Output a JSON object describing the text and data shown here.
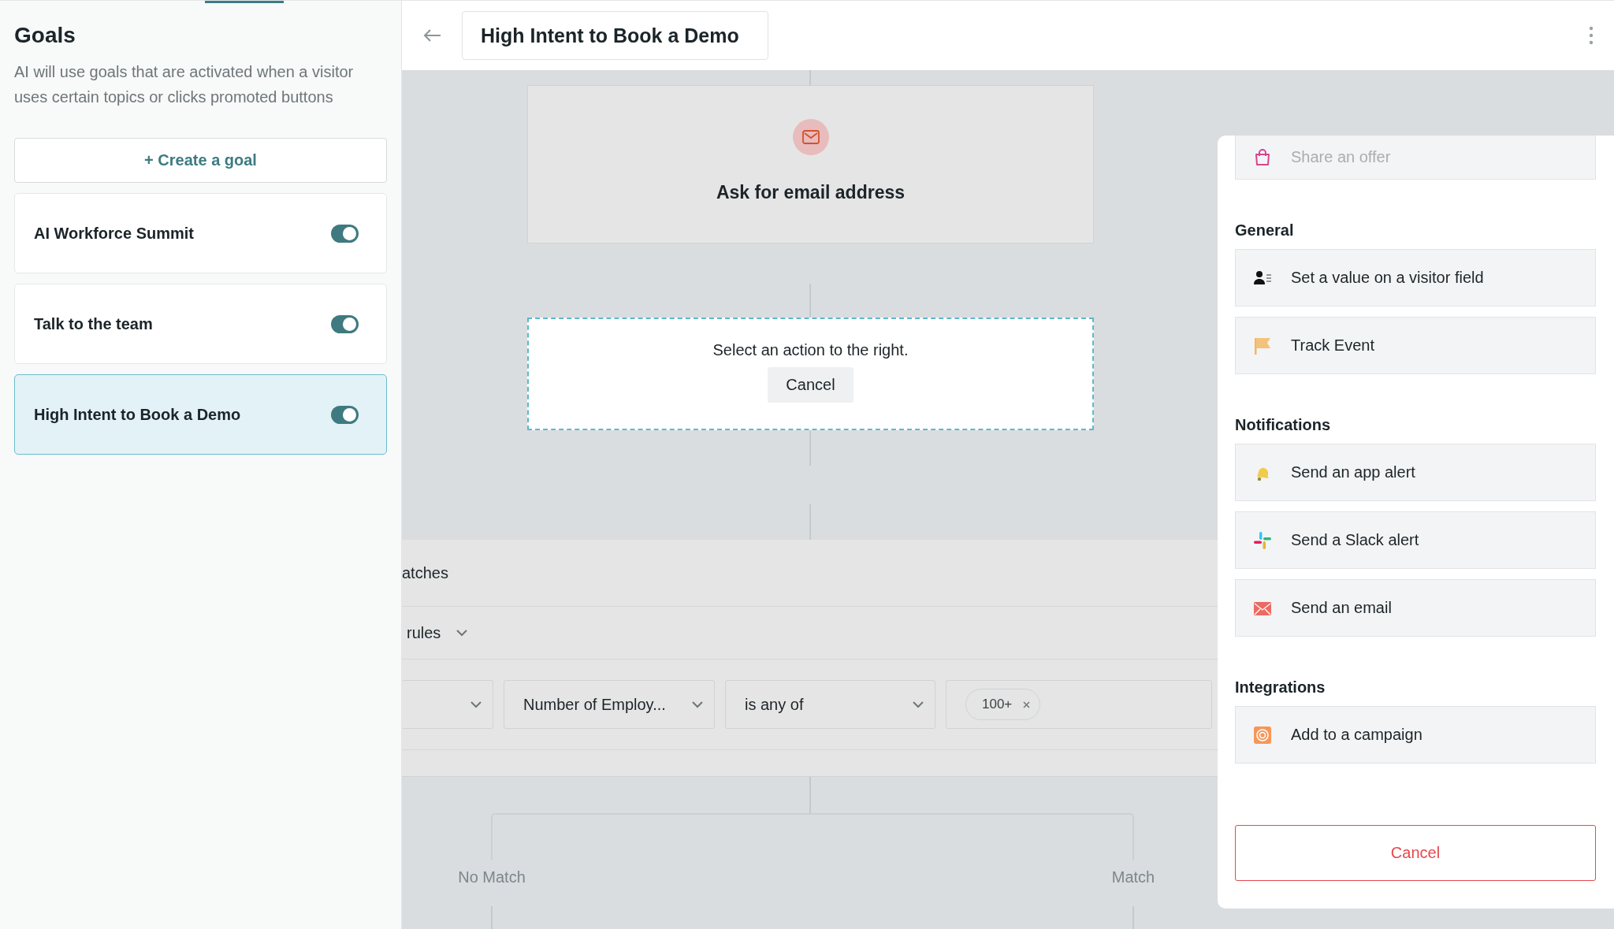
{
  "sidebar": {
    "title": "Goals",
    "description": "AI will use goals that are activated when a visitor uses certain topics or clicks promoted buttons",
    "create_button": "+ Create a goal",
    "goals": [
      {
        "name": "AI Workforce Summit",
        "on": true,
        "selected": false
      },
      {
        "name": "Talk to the team",
        "on": true,
        "selected": false
      },
      {
        "name": "High Intent to Book a Demo",
        "on": true,
        "selected": true
      }
    ]
  },
  "header": {
    "title": "High Intent to Book a Demo"
  },
  "flow": {
    "node": {
      "title": "Ask for email address"
    },
    "placeholder": {
      "text": "Select an action to the right.",
      "cancel": "Cancel"
    },
    "rules": {
      "match_label": "atches",
      "rules_label": "rules",
      "field": "Number of Employ...",
      "operator": "is any of",
      "tags": [
        "100+"
      ]
    },
    "branches": [
      "No Match",
      "Match"
    ]
  },
  "panel": {
    "sections": [
      {
        "items": [
          {
            "label": "Share an offer",
            "kind": "offer",
            "disabled": true
          }
        ]
      },
      {
        "heading": "General",
        "items": [
          {
            "label": "Set a value on a visitor field",
            "kind": "visitor",
            "disabled": false
          },
          {
            "label": "Track Event",
            "kind": "flag",
            "disabled": false
          }
        ]
      },
      {
        "heading": "Notifications",
        "items": [
          {
            "label": "Send an app alert",
            "kind": "bell",
            "disabled": false
          },
          {
            "label": "Send a Slack alert",
            "kind": "slack",
            "disabled": false
          },
          {
            "label": "Send an email",
            "kind": "email",
            "disabled": false
          }
        ]
      },
      {
        "heading": "Integrations",
        "items": [
          {
            "label": "Add to a campaign",
            "kind": "campaign",
            "disabled": false
          }
        ]
      }
    ],
    "cancel": "Cancel"
  }
}
